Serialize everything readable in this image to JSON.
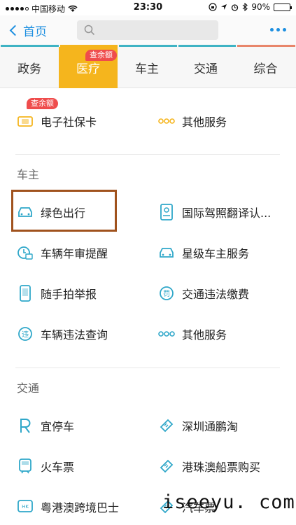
{
  "status_bar": {
    "carrier": "中国移动",
    "time": "23:30",
    "battery": "90%",
    "battery_level": 0.9
  },
  "nav": {
    "back_label": "首页"
  },
  "tabs": [
    {
      "label": "政务",
      "active": false
    },
    {
      "label": "医疗",
      "active": true,
      "badge": "查余额"
    },
    {
      "label": "车主",
      "active": false
    },
    {
      "label": "交通",
      "active": false
    },
    {
      "label": "综合",
      "active": false
    }
  ],
  "colors": {
    "accent": "#1d8fe0",
    "active_tab": "#f5b51d",
    "badge": "#ef4c4c",
    "highlight_border": "#a0521d",
    "icon_teal": "#2fa7c9"
  },
  "medical_section": {
    "items": [
      {
        "label": "电子社保卡",
        "icon": "social-security-card-icon",
        "badge": "查余额"
      },
      {
        "label": "其他服务",
        "icon": "more-dots-icon"
      }
    ]
  },
  "car_owner_section": {
    "title": "车主",
    "items": [
      {
        "label": "绿色出行",
        "icon": "car-icon"
      },
      {
        "label": "国际驾照翻译认...",
        "icon": "license-icon"
      },
      {
        "label": "车辆年审提醒",
        "icon": "inspection-clock-icon"
      },
      {
        "label": "星级车主服务",
        "icon": "car-icon"
      },
      {
        "label": "随手拍举报",
        "icon": "phone-icon"
      },
      {
        "label": "交通违法缴费",
        "icon": "fine-payment-icon"
      },
      {
        "label": "车辆违法查询",
        "icon": "violation-query-icon"
      },
      {
        "label": "其他服务",
        "icon": "more-dots-icon"
      }
    ]
  },
  "traffic_section": {
    "title": "交通",
    "items": [
      {
        "label": "宜停车",
        "icon": "parking-icon"
      },
      {
        "label": "深圳通鹏淘",
        "icon": "ticket-icon"
      },
      {
        "label": "火车票",
        "icon": "train-icon"
      },
      {
        "label": "港珠澳船票购买",
        "icon": "ticket-icon"
      },
      {
        "label": "粤港澳跨境巴士",
        "icon": "bus-hk-icon"
      },
      {
        "label": "汽车票",
        "icon": "ticket-icon"
      }
    ]
  },
  "watermark": "iseeyu. com"
}
